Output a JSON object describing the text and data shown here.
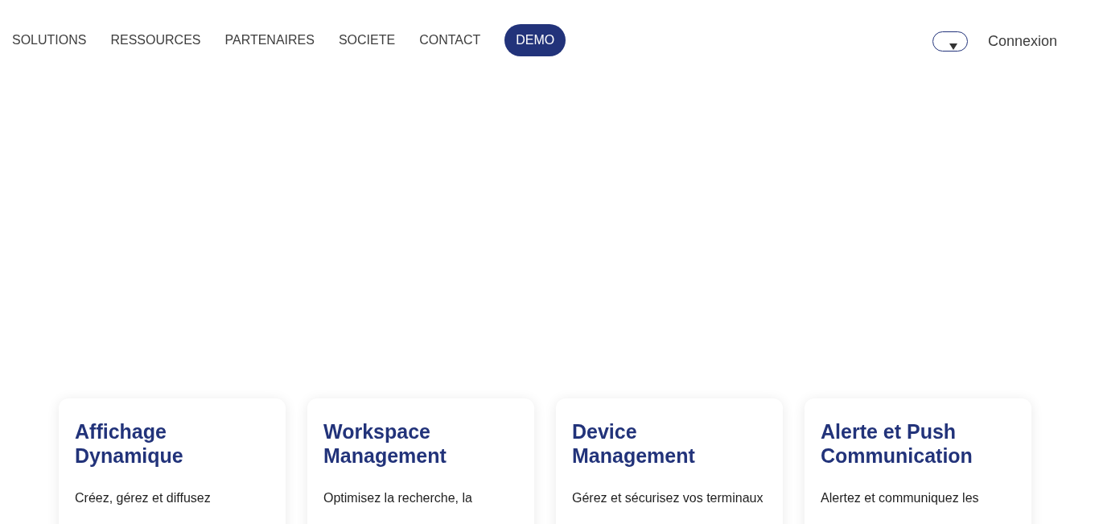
{
  "nav": {
    "items": [
      "SOLUTIONS",
      "RESSOURCES",
      "PARTENAIRES",
      "SOCIETE",
      "CONTACT"
    ],
    "cta": "DEMO",
    "login": "Connexion"
  },
  "cards": [
    {
      "title": "Affichage Dynamique",
      "text": "Créez, gérez et diffusez"
    },
    {
      "title": "Workspace Management",
      "text": "Optimisez la recherche, la"
    },
    {
      "title": "Device Management",
      "text": "Gérez et sécurisez vos terminaux"
    },
    {
      "title": "Alerte et Push Communication",
      "text": "Alertez et communiquez les"
    }
  ]
}
